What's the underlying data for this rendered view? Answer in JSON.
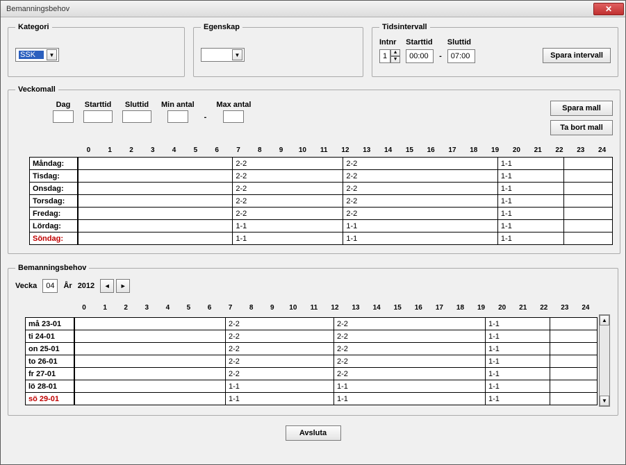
{
  "window": {
    "title": "Bemanningsbehov"
  },
  "kategori": {
    "legend": "Kategori",
    "selected": "SSK"
  },
  "egenskap": {
    "legend": "Egenskap",
    "selected": ""
  },
  "tids": {
    "legend": "Tidsintervall",
    "intnr_label": "Intnr",
    "intnr": "1",
    "starttid_label": "Starttid",
    "starttid": "00:00",
    "sluttid_label": "Sluttid",
    "sluttid": "07:00",
    "dash": "-",
    "save_label": "Spara intervall"
  },
  "veckomall": {
    "legend": "Veckomall",
    "cols": {
      "dag": "Dag",
      "starttid": "Starttid",
      "sluttid": "Sluttid",
      "min": "Min antal",
      "max": "Max antal",
      "dash": "-"
    },
    "save_label": "Spara mall",
    "del_label": "Ta bort mall",
    "hours": [
      "0",
      "1",
      "2",
      "3",
      "4",
      "5",
      "6",
      "7",
      "8",
      "9",
      "10",
      "11",
      "12",
      "13",
      "14",
      "15",
      "16",
      "17",
      "18",
      "19",
      "20",
      "21",
      "22",
      "23",
      "24"
    ],
    "rows": [
      {
        "day": "Måndag:",
        "seg": [
          "",
          "2-2",
          "2-2",
          "1-1",
          ""
        ]
      },
      {
        "day": "Tisdag:",
        "seg": [
          "",
          "2-2",
          "2-2",
          "1-1",
          ""
        ]
      },
      {
        "day": "Onsdag:",
        "seg": [
          "",
          "2-2",
          "2-2",
          "1-1",
          ""
        ]
      },
      {
        "day": "Torsdag:",
        "seg": [
          "",
          "2-2",
          "2-2",
          "1-1",
          ""
        ]
      },
      {
        "day": "Fredag:",
        "seg": [
          "",
          "2-2",
          "2-2",
          "1-1",
          ""
        ]
      },
      {
        "day": "Lördag:",
        "seg": [
          "",
          "1-1",
          "1-1",
          "1-1",
          ""
        ]
      },
      {
        "day": "Söndag:",
        "seg": [
          "",
          "1-1",
          "1-1",
          "1-1",
          ""
        ],
        "red": true
      }
    ]
  },
  "bemann": {
    "legend": "Bemanningsbehov",
    "vecka_label": "Vecka",
    "vecka": "04",
    "ar_label": "År",
    "ar": "2012",
    "hours": [
      "0",
      "1",
      "2",
      "3",
      "4",
      "5",
      "6",
      "7",
      "8",
      "9",
      "10",
      "11",
      "12",
      "13",
      "14",
      "15",
      "16",
      "17",
      "18",
      "19",
      "20",
      "21",
      "22",
      "23",
      "24"
    ],
    "rows": [
      {
        "day": "må 23-01",
        "seg": [
          "",
          "2-2",
          "2-2",
          "1-1",
          ""
        ]
      },
      {
        "day": "ti 24-01",
        "seg": [
          "",
          "2-2",
          "2-2",
          "1-1",
          ""
        ]
      },
      {
        "day": "on 25-01",
        "seg": [
          "",
          "2-2",
          "2-2",
          "1-1",
          ""
        ]
      },
      {
        "day": "to 26-01",
        "seg": [
          "",
          "2-2",
          "2-2",
          "1-1",
          ""
        ]
      },
      {
        "day": "fr 27-01",
        "seg": [
          "",
          "2-2",
          "2-2",
          "1-1",
          ""
        ]
      },
      {
        "day": "lö 28-01",
        "seg": [
          "",
          "1-1",
          "1-1",
          "1-1",
          ""
        ]
      },
      {
        "day": "sö 29-01",
        "seg": [
          "",
          "1-1",
          "1-1",
          "1-1",
          ""
        ],
        "red": true
      }
    ]
  },
  "footer": {
    "close_label": "Avsluta"
  }
}
